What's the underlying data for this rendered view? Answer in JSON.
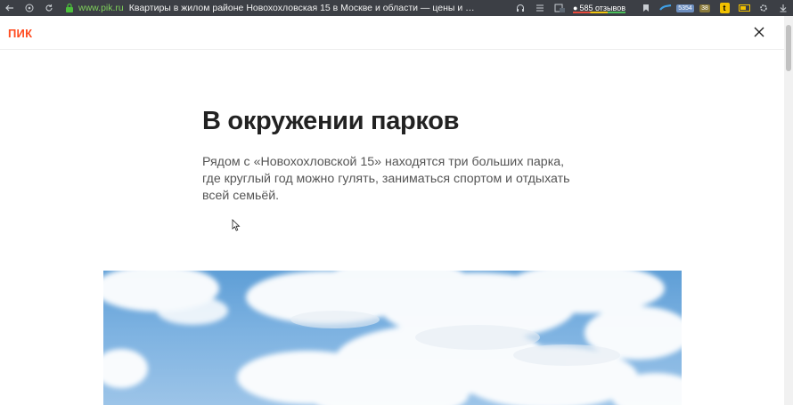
{
  "browser": {
    "domain": "www.pik.ru",
    "tab_title": "Квартиры в жилом районе Новохохловская 15 в Москве и области — цены и планиров…",
    "reviews_count": "585 отзывов",
    "badge_count": "5354",
    "weather_badge": "38",
    "yandex_letter": "t"
  },
  "site": {
    "logo": "ПИК"
  },
  "section": {
    "title": "В окружении парков",
    "description": "Рядом с «Новохохловской 15» находятся три больших парка, где круглый год можно гулять, заниматься спортом и отдыхать всей семьёй."
  },
  "colors": {
    "brand": "#ff4b1f",
    "heading": "#222222",
    "text": "#555555",
    "chrome": "#3c3f45"
  }
}
